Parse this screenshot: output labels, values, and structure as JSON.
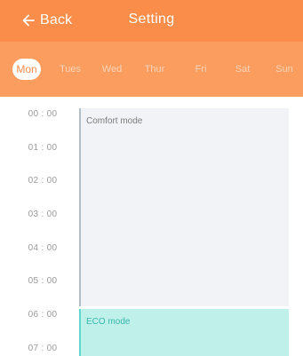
{
  "header": {
    "back_label": "Back",
    "title": "Setting",
    "background": "#fa8d4a"
  },
  "days": {
    "background": "#fb9d5f",
    "selected": "Mon",
    "items": [
      "Mon",
      "Tues",
      "Wed",
      "Thur",
      "Fri",
      "Sat",
      "Sun"
    ]
  },
  "timeline": {
    "times": [
      "00 : 00",
      "01 : 00",
      "02 : 00",
      "03 : 00",
      "04 : 00",
      "05 : 00",
      "06 : 00",
      "07 : 00"
    ],
    "blocks": [
      {
        "label": "Comfort mode",
        "color": "#f1f3f6",
        "text_color": "#7b7b7b"
      },
      {
        "label": "ECO mode",
        "color": "#bff1ea",
        "text_color": "#36b5ab"
      }
    ]
  }
}
